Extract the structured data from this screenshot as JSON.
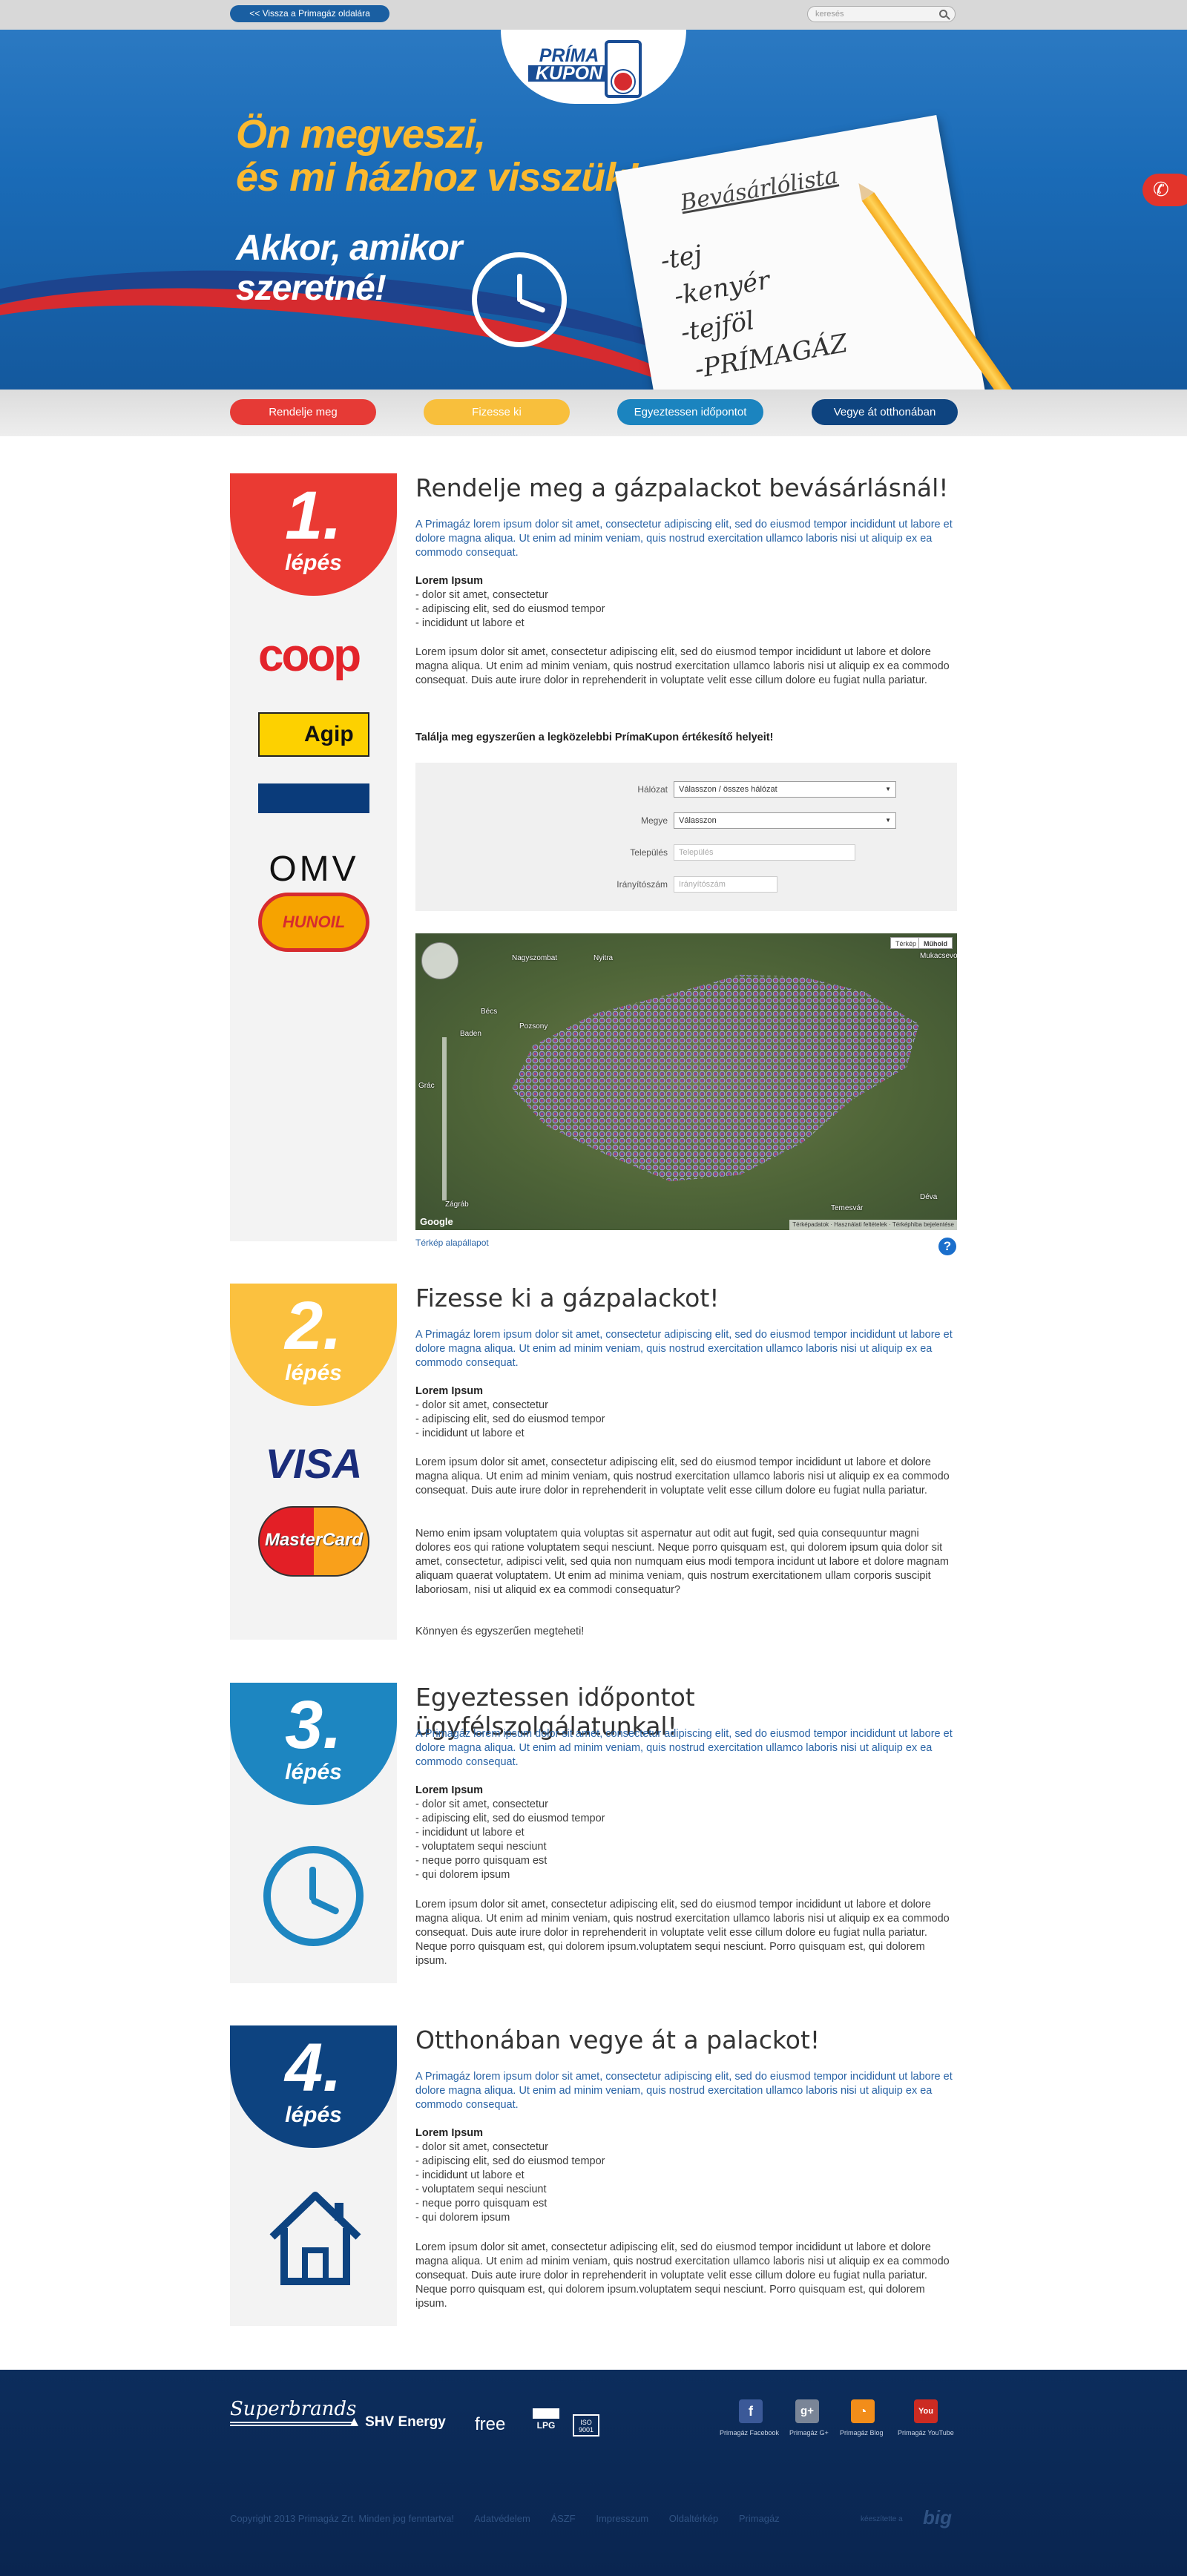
{
  "topbar": {
    "back_label": "<< Vissza a Primagáz oldalára",
    "search_placeholder": "keresés"
  },
  "logo": {
    "line1": "PRÍMA",
    "line2": "KUPON"
  },
  "hero": {
    "headline1": "Ön megveszi,",
    "headline2": "és mi házhoz visszük!",
    "sub1": "Akkor, amikor",
    "sub2": "szeretné!",
    "list_title": "Bevásárlólista",
    "list_items": [
      "-tej",
      "-kenyér",
      "-tejföl",
      "-PRÍMAGÁZ"
    ]
  },
  "nav": [
    {
      "label": "Rendelje meg",
      "color": "#e63a36"
    },
    {
      "label": "Fizesse ki",
      "color": "#f8bf3c"
    },
    {
      "label": "Egyeztessen időpontot",
      "color": "#1b84bf"
    },
    {
      "label": "Vegye át otthonában",
      "color": "#0e4480"
    }
  ],
  "steps": [
    {
      "num": "1.",
      "lep": "lépés",
      "color": "#ea3a33",
      "title": "Rendelje meg a gázpalackot bevásárlásnál!",
      "intro": "A Primagáz lorem ipsum dolor sit amet, consectetur adipiscing elit, sed do eiusmod tempor incididunt ut labore et dolore magna aliqua. Ut enim ad minim veniam, quis nostrud exercitation ullamco laboris nisi ut aliquip ex ea commodo consequat.",
      "list_title": "Lorem Ipsum",
      "list": [
        "- dolor sit amet, consectetur",
        "- adipiscing elit, sed do eiusmod tempor",
        "- incididunt ut labore et"
      ],
      "body": [
        "Lorem ipsum dolor sit amet, consectetur adipiscing elit, sed do eiusmod tempor incididunt ut labore et dolore magna aliqua. Ut enim ad minim veniam, quis nostrud exercitation ullamco laboris nisi ut aliquip ex ea commodo consequat. Duis aute irure dolor in reprehenderit in voluptate velit esse cillum dolore eu fugiat nulla pariatur."
      ],
      "finder_title": "Találja meg egyszerűen a legközelebbi PrímaKupon értékesítő helyeit!",
      "finder": {
        "network_label": "Hálózat",
        "network_value": "Válasszon / összes hálózat",
        "county_label": "Megye",
        "county_value": "Válasszon",
        "city_label": "Település",
        "city_placeholder": "Település",
        "zip_label": "Irányítószám",
        "zip_placeholder": "Irányítószám"
      },
      "map": {
        "btn_map": "Térkép",
        "btn_sat": "Műhold",
        "footer": "Térképadatok · Használati feltételek · Térképhiba bejelentése",
        "google": "Google",
        "link": "Térkép alapállapot",
        "cities": [
          "Bécs",
          "Pozsony",
          "Nyitra",
          "Nagyszombat",
          "Baden",
          "Grác",
          "Zágráb",
          "Temesvár",
          "Déva",
          "Mukacsevo"
        ]
      },
      "brands": [
        "coop",
        "Agip",
        "OMV",
        "HUNOIL"
      ]
    },
    {
      "num": "2.",
      "lep": "lépés",
      "color": "#fbc13f",
      "title": "Fizesse ki a gázpalackot!",
      "intro": "A Primagáz lorem ipsum dolor sit amet, consectetur adipiscing elit, sed do eiusmod tempor incididunt ut labore et dolore magna aliqua. Ut enim ad minim veniam, quis nostrud exercitation ullamco laboris nisi ut aliquip ex ea commodo consequat.",
      "list_title": "Lorem Ipsum",
      "list": [
        "- dolor sit amet, consectetur",
        "- adipiscing elit, sed do eiusmod tempor",
        "- incididunt ut labore et"
      ],
      "body": [
        "Lorem ipsum dolor sit amet, consectetur adipiscing elit, sed do eiusmod tempor incididunt ut labore et dolore magna aliqua. Ut enim ad minim veniam, quis nostrud exercitation ullamco laboris nisi ut aliquip ex ea commodo consequat. Duis aute irure dolor in reprehenderit in voluptate velit esse cillum dolore eu fugiat nulla pariatur.",
        "Nemo enim ipsam voluptatem quia voluptas sit aspernatur aut odit aut fugit, sed quia consequuntur magni dolores eos qui ratione voluptatem sequi nesciunt. Neque porro quisquam est, qui dolorem ipsum quia dolor sit amet, consectetur, adipisci velit, sed quia non numquam eius modi tempora incidunt ut labore et dolore magnam aliquam quaerat voluptatem. Ut enim ad minima veniam, quis nostrum exercitationem ullam corporis suscipit laboriosam, nisi ut aliquid ex ea commodi consequatur?",
        "Könnyen és egyszerűen megteheti!"
      ],
      "brands": [
        "VISA",
        "MasterCard"
      ]
    },
    {
      "num": "3.",
      "lep": "lépés",
      "color": "#1d86c1",
      "title": "Egyeztessen időpontot ügyfélszolgálatunkal!",
      "intro": "A Primagáz lorem ipsum dolor sit amet, consectetur adipiscing elit, sed do eiusmod tempor incididunt ut labore et dolore magna aliqua. Ut enim ad minim veniam, quis nostrud exercitation ullamco laboris nisi ut aliquip ex ea commodo consequat.",
      "list_title": "Lorem Ipsum",
      "list": [
        "- dolor sit amet, consectetur",
        "- adipiscing elit, sed do eiusmod tempor",
        "- incididunt ut labore et",
        "- voluptatem sequi nesciunt",
        "- neque porro quisquam est",
        "- qui dolorem ipsum"
      ],
      "body": [
        "Lorem ipsum dolor sit amet, consectetur adipiscing elit, sed do eiusmod tempor incididunt ut labore et dolore magna aliqua. Ut enim ad minim veniam, quis nostrud exercitation ullamco laboris nisi ut aliquip ex ea commodo consequat. Duis aute irure dolor in reprehenderit in voluptate velit esse cillum dolore eu fugiat nulla pariatur. Neque porro quisquam est, qui dolorem ipsum.voluptatem sequi nesciunt. Porro quisquam est, qui dolorem ipsum."
      ]
    },
    {
      "num": "4.",
      "lep": "lépés",
      "color": "#0d4380",
      "title": "Otthonában vegye át a palackot!",
      "intro": "A Primagáz lorem ipsum dolor sit amet, consectetur adipiscing elit, sed do eiusmod tempor incididunt ut labore et dolore magna aliqua. Ut enim ad minim veniam, quis nostrud exercitation ullamco laboris nisi ut aliquip ex ea commodo consequat.",
      "list_title": "Lorem Ipsum",
      "list": [
        "- dolor sit amet, consectetur",
        "- adipiscing elit, sed do eiusmod tempor",
        "- incididunt ut labore et",
        "- voluptatem sequi nesciunt",
        "- neque porro quisquam est",
        "- qui dolorem ipsum"
      ],
      "body": [
        "Lorem ipsum dolor sit amet, consectetur adipiscing elit, sed do eiusmod tempor incididunt ut labore et dolore magna aliqua. Ut enim ad minim veniam, quis nostrud exercitation ullamco laboris nisi ut aliquip ex ea commodo consequat. Duis aute irure dolor in reprehenderit in voluptate velit esse cillum dolore eu fugiat nulla pariatur. Neque porro quisquam est, qui dolorem ipsum.voluptatem sequi nesciunt. Porro quisquam est, qui dolorem ipsum."
      ]
    }
  ],
  "footer": {
    "brands": [
      "Superbrands",
      "SHV Energy",
      "free",
      "LPG",
      "ISO 9001"
    ],
    "social": [
      {
        "label": "Primagáz Facebook",
        "glyph": "f",
        "color": "#3b5998"
      },
      {
        "label": "Primagáz G+",
        "glyph": "g+",
        "color": "#7a8597"
      },
      {
        "label": "Primagáz Blog",
        "glyph": "◔",
        "color": "#f28d1a"
      },
      {
        "label": "Primagáz YouTube",
        "glyph": "You",
        "color": "#cc2b22"
      }
    ],
    "links": [
      "Copyright 2013 Primagáz Zrt. Minden jog fenntartva!",
      "Adatvédelem",
      "ÁSZF",
      "Impresszum",
      "Oldaltérkép",
      "Primagáz"
    ],
    "made_by": "kéeszítette a",
    "made_logo": "big"
  }
}
